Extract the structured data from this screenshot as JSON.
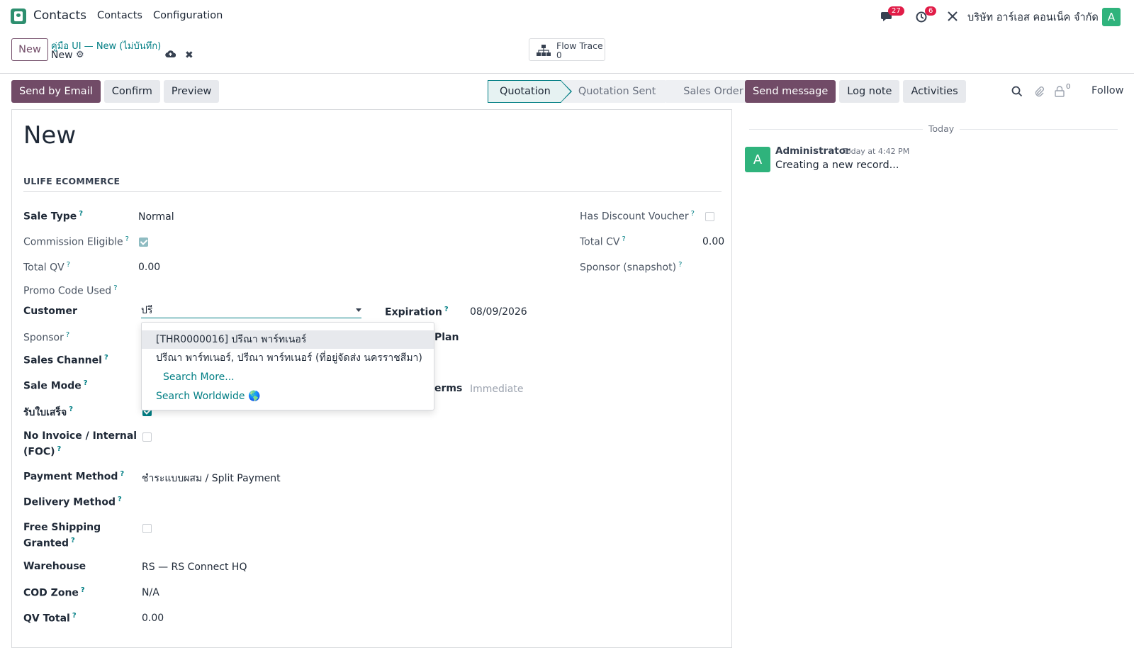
{
  "app": {
    "name": "Contacts"
  },
  "menu": {
    "items": [
      "Contacts",
      "Configuration"
    ]
  },
  "systray": {
    "messages_count": "27",
    "activities_count": "6",
    "company": "บริษัท อาร์เอส คอนเน็ค จำกัด",
    "avatar_letter": "A"
  },
  "control": {
    "new_label": "New",
    "breadcrumb_parent": "คู่มือ UI — New (ไม่บันทึก)",
    "breadcrumb_current": "New",
    "flow_trace_label": "Flow Trace",
    "flow_trace_count": "0"
  },
  "actions": {
    "send_email": "Send by Email",
    "confirm": "Confirm",
    "preview": "Preview"
  },
  "status": {
    "stages": [
      "Quotation",
      "Quotation Sent",
      "Sales Order"
    ],
    "current": "Quotation"
  },
  "form": {
    "title": "New",
    "section": "ULIFE ECOMMERCE",
    "sale_type_label": "Sale Type",
    "sale_type_value": "Normal",
    "commission_label": "Commission Eligible",
    "commission_checked": true,
    "total_qv_label": "Total QV",
    "total_qv_value": "0.00",
    "promo_label": "Promo Code Used",
    "customer_label": "Customer",
    "customer_value": "ปรี",
    "sponsor_label": "Sponsor",
    "sales_channel_label": "Sales Channel",
    "sale_mode_label": "Sale Mode",
    "receipt_label": "รับใบเสร็จ",
    "receipt_checked": true,
    "no_invoice_label_1": "No Invoice / Internal",
    "no_invoice_label_2": "(FOC)",
    "payment_method_label": "Payment Method",
    "payment_method_value": "ชำระแบบผสม / Split Payment",
    "delivery_method_label": "Delivery Method",
    "free_shipping_label_1": "Free Shipping",
    "free_shipping_label_2": "Granted",
    "warehouse_label": "Warehouse",
    "warehouse_value": "RS — RS Connect HQ",
    "cod_zone_label": "COD Zone",
    "cod_zone_value": "N/A",
    "qv_total_label": "QV Total",
    "qv_total_value": "0.00",
    "has_discount_label": "Has Discount Voucher",
    "total_cv_label": "Total CV",
    "total_cv_value": "0.00",
    "sponsor_snapshot_label": "Sponsor (snapshot)",
    "expiration_label": "Expiration",
    "expiration_value": "08/09/2026",
    "pricelist_label_partial": "Plan",
    "payment_terms_label_partial": "erms",
    "payment_terms_value": "Immediate"
  },
  "dropdown": {
    "items": [
      "[THR0000016] ปรีณา พาร์ทเนอร์",
      "ปรีณา พาร์ทเนอร์, ปรีณา พาร์ทเนอร์ (ที่อยู่จัดส่ง นครราชสีมา)"
    ],
    "search_more": "Search More...",
    "search_worldwide": "Search Worldwide 🌎"
  },
  "chatter": {
    "send_message": "Send message",
    "log_note": "Log note",
    "activities": "Activities",
    "followers_count": "0",
    "follow": "Follow",
    "today": "Today",
    "author": "Administrator",
    "time": "Today at 4:42 PM",
    "body": "Creating a new record...",
    "author_avatar": "A"
  },
  "colors": {
    "brand": "#714b67",
    "accent": "#017e84",
    "badge": "#e11d48",
    "avatar": "#2fb37c"
  }
}
